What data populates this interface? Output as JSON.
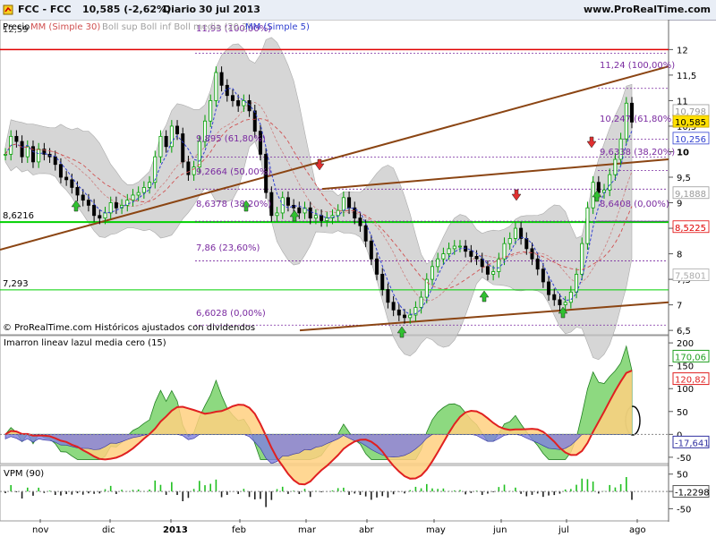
{
  "header": {
    "ticker": "FCC - FCC",
    "price_change": "10,585 (-2,62%)",
    "period": "Diario",
    "date": "30 jul 2013",
    "site": "www.ProRealTime.com"
  },
  "colors": {
    "up": "#00a000",
    "down": "#000000",
    "bollinger": "#c8c8c8",
    "sma30": "#d05050",
    "sma5": "#3040d0",
    "trendline": "#8b4513",
    "hline_red": "#e00000",
    "hline_green": "#00d000",
    "fib": "#7a2aa0",
    "macd_line": "#20c020",
    "macd_signal": "#e02020",
    "macd_zero_fill": "#8080e0"
  },
  "main_panel": {
    "legend": [
      {
        "text": "Precio",
        "color": "#000000"
      },
      {
        "text": "MM (Simple 30)",
        "color": "#d05050"
      },
      {
        "text": "Boll sup Boll inf Boll media (20,2)",
        "color": "#a0a0a0"
      },
      {
        "text": "MM (Simple 5)",
        "color": "#3040d0"
      }
    ],
    "copyright": "© ProRealTime.com Históricos ajustados con dividendos",
    "left_labels": [
      "8,6216",
      "7,293"
    ],
    "top_left_value": "12,59",
    "y_ticks": [
      "12",
      "11,5",
      "11",
      "10,5",
      "10",
      "9,5",
      "9",
      "8,5",
      "8",
      "7,5",
      "7",
      "6,5"
    ],
    "price_tags": [
      "10,798",
      "10,585",
      "10,256",
      "9,1888",
      "8,5225",
      "7,5801"
    ],
    "fib_labels": [
      "11,93 (100,00%)",
      "9,895 (61,80%)",
      "9,2664 (50,00%)",
      "8,6378 (38,20%)",
      "7,86 (23,60%)",
      "6,6028 (0,00%)",
      "11,24 (100,00%)",
      "10,247 (61,80%)",
      "9,6338 (38,20%)",
      "8,6408 (0,00%)"
    ]
  },
  "macd_panel": {
    "title": "Imarron lineav lazul media cero (15)",
    "y_ticks": [
      "200",
      "150",
      "100",
      "50",
      "0",
      "-50"
    ],
    "tags": [
      "170,06",
      "120,82",
      "-17,641"
    ]
  },
  "vpm_panel": {
    "title": "VPM (90)",
    "y_ticks": [
      "50",
      "0",
      "-50"
    ],
    "tag": "-1,2298"
  },
  "x_axis": {
    "labels": [
      "nov",
      "dic",
      "2013",
      "feb",
      "mar",
      "abr",
      "may",
      "jun",
      "jul",
      "ago"
    ]
  },
  "chart_data": {
    "type": "line",
    "series": [
      {
        "values": [
          9.95,
          10.3,
          10.2,
          9.9,
          10.1,
          9.8,
          10.05,
          9.95,
          9.9,
          9.75,
          9.5,
          9.45,
          9.3,
          9.15,
          9.05,
          8.95,
          8.75,
          8.7,
          8.8,
          9.0,
          8.9,
          8.95,
          9.05,
          9.15,
          9.2,
          9.3,
          9.4,
          9.9,
          10.3,
          10.1,
          10.5,
          10.35,
          9.8,
          9.55,
          9.7,
          10.2,
          10.6,
          11.0,
          11.55,
          11.3,
          11.1,
          11.0,
          10.9,
          11.0,
          10.8,
          10.4,
          9.95,
          9.2,
          8.75,
          8.8,
          9.1,
          8.95,
          8.9,
          8.8,
          8.9,
          8.7,
          8.75,
          8.65,
          8.7,
          8.75,
          8.85,
          9.1,
          8.9,
          8.7,
          8.55,
          8.25,
          7.9,
          7.6,
          7.3,
          7.05,
          6.9,
          6.8,
          6.75,
          6.8,
          6.95,
          7.15,
          7.5,
          7.75,
          7.9,
          8.0,
          8.1,
          8.15,
          8.15,
          8.05,
          7.95,
          7.9,
          7.75,
          7.6,
          7.65,
          7.9,
          8.2,
          8.3,
          8.5,
          8.3,
          8.1,
          7.9,
          7.7,
          7.45,
          7.2,
          7.1,
          7.0,
          7.05,
          7.25,
          7.6,
          8.2,
          8.9,
          9.4,
          9.2,
          9.25,
          9.55,
          9.85,
          10.25,
          10.95,
          10.58
        ],
        "x_range": [
          "oct 2012",
          "30 jul 2013"
        ]
      }
    ],
    "ylim": [
      6.45,
      12.55
    ],
    "y_ticks": [
      12,
      11.5,
      11,
      10.5,
      10,
      9.5,
      9,
      8.5,
      8,
      7.5,
      7,
      6.5
    ],
    "hlines": [
      {
        "value": 12.0,
        "label": "12,59"
      },
      {
        "value": 8.6216,
        "label": "8,6216"
      },
      {
        "value": 7.293,
        "label": "7,293"
      }
    ],
    "last_close": 10.585,
    "change_pct": -2.62
  }
}
